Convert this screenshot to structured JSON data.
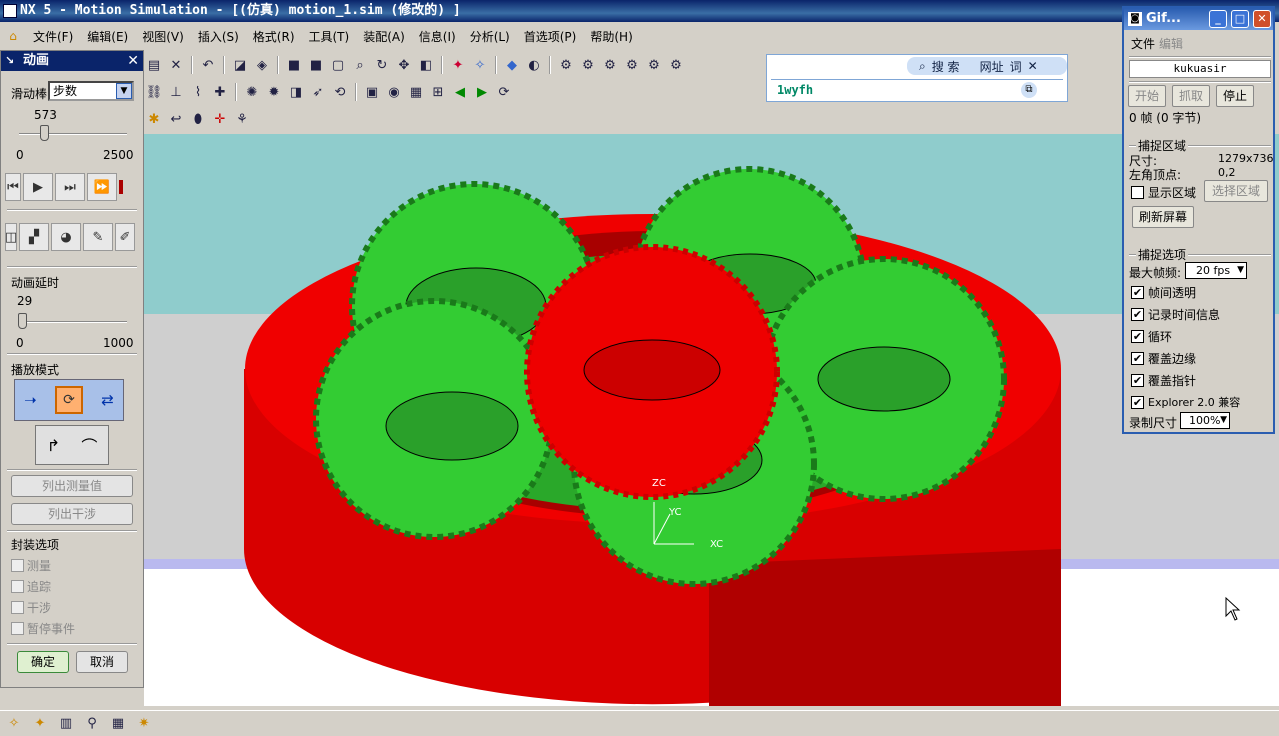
{
  "window": {
    "title": "NX 5 - Motion Simulation - [(仿真) motion_1.sim (修改的) ]"
  },
  "menu": [
    "文件(F)",
    "编辑(E)",
    "视图(V)",
    "插入(S)",
    "格式(R)",
    "工具(T)",
    "装配(A)",
    "信息(I)",
    "分析(L)",
    "首选项(P)",
    "帮助(H)"
  ],
  "search_bar": {
    "search_label": "搜 索",
    "url_label": "网址",
    "word_label": "词",
    "value": "1wyfh"
  },
  "animation_panel": {
    "title": "动画",
    "slider_label": "滑动棒",
    "slider_mode": "步数",
    "slider_value": "573",
    "slider_min": "0",
    "slider_max": "2500",
    "slider_fraction": 0.229,
    "delay_label": "动画延时",
    "delay_value": "29",
    "delay_min": "0",
    "delay_max": "1000",
    "delay_fraction": 0.029,
    "playback_label": "播放模式",
    "list_measure": "列出测量值",
    "list_interference": "列出干涉",
    "package_label": "封装选项",
    "options": [
      "测量",
      "追踪",
      "干涉",
      "暂停事件"
    ],
    "ok": "确定",
    "cancel": "取消"
  },
  "gif_window": {
    "title": "Gif...",
    "menu_file": "文件",
    "menu_edit": "编辑",
    "user": "kukuasir",
    "start": "开始",
    "capture": "抓取",
    "stop": "停止",
    "frames": "0 帧 (0 字节)",
    "capture_area_label": "捕捉区域",
    "size_label": "尺寸:",
    "size_value": "1279x736",
    "topleft_label": "左角顶点:",
    "topleft_value": "0,2",
    "show_area": "显示区域",
    "select_area": "选择区域",
    "refresh": "刷新屏幕",
    "capture_options_label": "捕捉选项",
    "max_fps_label": "最大帧频:",
    "max_fps_value": "20 fps",
    "options": [
      "帧间透明",
      "记录时间信息",
      "循环",
      "覆盖边缘",
      "覆盖指针",
      "Explorer 2.0 兼容"
    ],
    "record_size_label": "录制尺寸",
    "record_size_value": "100%"
  },
  "viewport": {
    "axis_z": "ZC",
    "axis_y": "YC",
    "axis_x": "XC"
  }
}
